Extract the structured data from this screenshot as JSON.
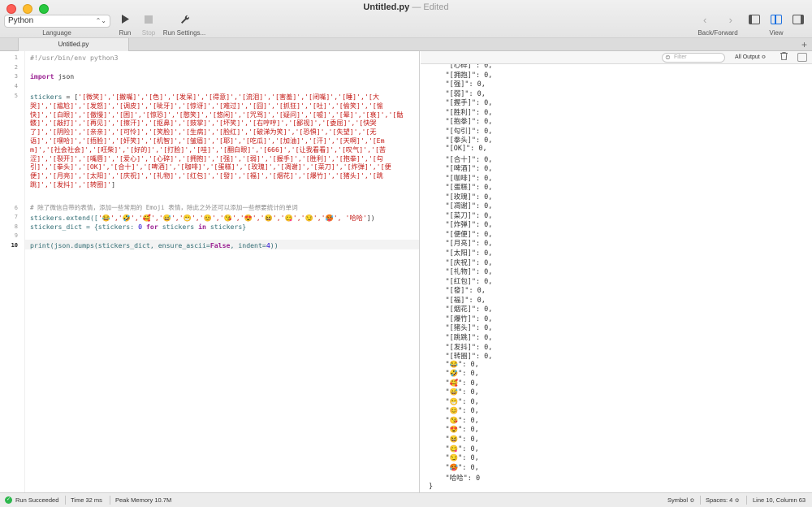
{
  "window": {
    "title": "Untitled.py",
    "separator": "—",
    "status": "Edited"
  },
  "toolbar": {
    "language_value": "Python",
    "language_label": "Language",
    "run_label": "Run",
    "stop_label": "Stop",
    "settings_label": "Run Settings...",
    "backforward_label": "Back/Forward",
    "view_label": "View"
  },
  "tabs": [
    {
      "label": "Untitled.py"
    }
  ],
  "editor": {
    "line_numbers": [
      "1",
      "2",
      "3",
      "4",
      "5",
      "6",
      "7",
      "8",
      "9",
      "10"
    ],
    "line1": "#!/usr/bin/env python3",
    "line3_kw": "import",
    "line3_mod": " json",
    "line5_lead": "stickers",
    "line5_op": " = [",
    "line5_items": "'[微笑]','[撇嘴]','[色]','[发呆]','[得意]','[流泪]','[害羞]','[闭嘴]','[睡]','[大哭]','[尴尬]','[发怒]','[调皮]','[呲牙]','[惊讶]','[难过]','[囧]','[抓狂]','[吐]','[偷笑]','[愉快]','[白眼]','[傲慢]','[困]','[惊恐]','[憨笑]','[悠闲]','[咒骂]','[疑问]','[嘘]','[晕]','[衰]','[骷髅]','[敲打]','[再见]','[擦汗]','[抠鼻]','[鼓掌]','[坏笑]','[右哼哼]','[鄙视]','[委屈]','[快哭了]','[阴险]','[亲亲]','[可怜]','[笑脸]','[生病]','[脸红]','[破涕为笑]','[恐惧]','[失望]','[无语]','[嘿哈]','[捂脸]','[奸笑]','[机智]','[皱眉]','[耶]','[吃瓜]','[加油]','[汗]','[天啊]','[Emm]','[社会社会]','[旺柴]','[好的]','[打脸]','[哇]','[翻白眼]','[666]','[让我看看]','[叹气]','[苦涩]','[裂开]','[嘴唇]','[爱心]','[心碎]','[拥抱]','[强]','[弱]','[握手]','[胜利]','[抱拳]','[勾引]','[拳头]','[OK]','[合十]','[啤酒]','[咖啡]','[蛋糕]','[玫瑰]','[凋谢]','[菜刀]','[炸弹]','[便便]','[月亮]','[太阳]','[庆祝]','[礼物]','[红包]','[發]','[福]','[烟花]','[爆竹]','[猪头]','[跳跳]','[发抖]','[转圈]'",
    "line5_end": "]",
    "line6_comment": "# 除了微信自带的表情，添加一些常用的 Emoji 表情，除此之外还可以添加一些想要统计的单词",
    "line7_lead": "stickers.extend([",
    "line7_emojis": "'😂','🤣','🥰','😅','😁','😊','😘','😍','😆','😋','😏','🥵',",
    "line7_word": " '哈哈'",
    "line7_end": "])",
    "line8_a": "stickers_dict = {stickers: ",
    "line8_num": "0",
    "line8_for": " for ",
    "line8_b": "stickers ",
    "line8_in": "in",
    "line8_c": " stickers}",
    "line10_a": "print(json.dumps(stickers_dict, ensure_ascii=",
    "line10_false": "False",
    "line10_b": ", indent=",
    "line10_num": "4",
    "line10_c": "))"
  },
  "console": {
    "filter_placeholder": "Filter",
    "output_select": "All Output ≎",
    "lines": [
      "    \"[心碎]\": 0,",
      "    \"[拥抱]\": 0,",
      "    \"[强]\": 0,",
      "    \"[弱]\": 0,",
      "    \"[握手]\": 0,",
      "    \"[胜利]\": 0,",
      "    \"[抱拳]\": 0,",
      "    \"[勾引]\": 0,",
      "    \"[拳头]\": 0,",
      "    \"[OK]\": 0,",
      "    \"[合十]\": 0,",
      "    \"[啤酒]\": 0,",
      "    \"[咖啡]\": 0,",
      "    \"[蛋糕]\": 0,",
      "    \"[玫瑰]\": 0,",
      "    \"[凋谢]\": 0,",
      "    \"[菜刀]\": 0,",
      "    \"[炸弹]\": 0,",
      "    \"[便便]\": 0,",
      "    \"[月亮]\": 0,",
      "    \"[太阳]\": 0,",
      "    \"[庆祝]\": 0,",
      "    \"[礼物]\": 0,",
      "    \"[红包]\": 0,",
      "    \"[發]\": 0,",
      "    \"[福]\": 0,",
      "    \"[烟花]\": 0,",
      "    \"[爆竹]\": 0,",
      "    \"[猪头]\": 0,",
      "    \"[跳跳]\": 0,",
      "    \"[发抖]\": 0,",
      "    \"[转圈]\": 0,",
      "    \"😂\": 0,",
      "    \"🤣\": 0,",
      "    \"🥰\": 0,",
      "    \"😅\": 0,",
      "    \"😁\": 0,",
      "    \"😊\": 0,",
      "    \"😘\": 0,",
      "    \"😍\": 0,",
      "    \"😆\": 0,",
      "    \"😋\": 0,",
      "    \"😏\": 0,",
      "    \"🥵\": 0,",
      "    \"哈哈\": 0",
      "}"
    ]
  },
  "statusbar": {
    "run_status": "Run Succeeded",
    "time": "Time 32 ms",
    "memory": "Peak Memory 10.7M",
    "symbol": "Symbol ≎",
    "spaces": "Spaces: 4 ≎",
    "position": "Line 10, Column 63"
  },
  "icons": {
    "run": "play-icon",
    "stop": "stop-icon",
    "settings": "wrench-icon",
    "filter": "filter-icon",
    "trash": "trash-icon"
  }
}
